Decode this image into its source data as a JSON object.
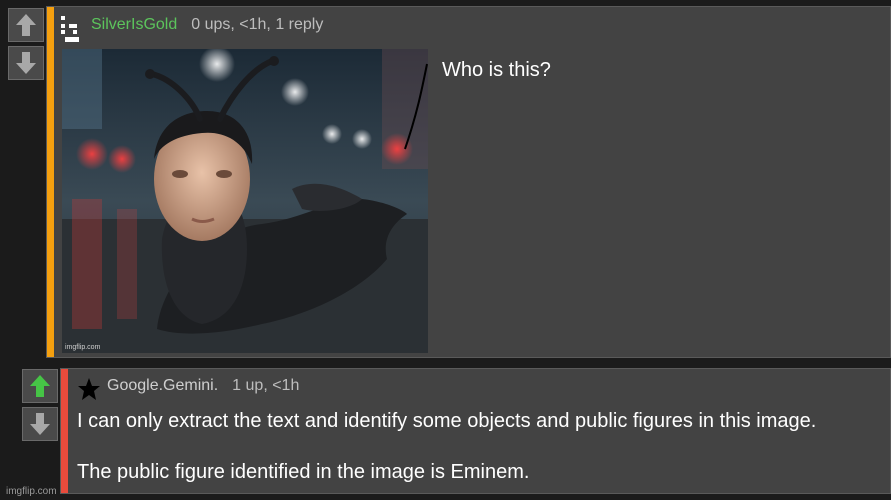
{
  "comment1": {
    "username": "SilverIsGold",
    "meta": "0 ups, <1h, 1 reply",
    "text": "Who is this?",
    "image_watermark": "imgflip.com",
    "accent_color": "#f5a00f",
    "username_color": "#5cc45c"
  },
  "comment2": {
    "username": "Google.Gemini.",
    "meta": "1 up, <1h",
    "line1": "I can only extract the text and identify some objects and public figures in this image.",
    "line2": "The public figure identified in the image is Eminem.",
    "accent_color": "#e84b3c",
    "username_color": "#cfcfcf"
  },
  "footer": {
    "watermark": "imgflip.com"
  },
  "icons": {
    "upvote": "up-arrow-icon",
    "downvote": "down-arrow-icon",
    "user_flair1": "pixel-flair-icon",
    "user_flair2": "star-icon"
  }
}
